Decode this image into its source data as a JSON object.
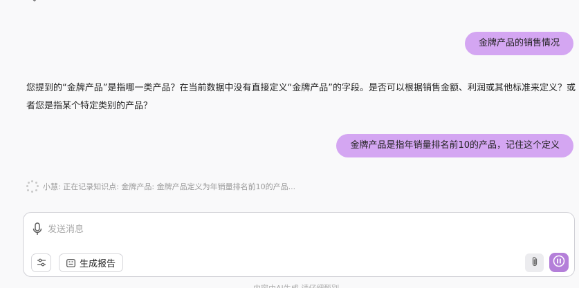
{
  "conversation": {
    "messages": [
      {
        "role": "user",
        "text": "金牌产品的销售情况"
      },
      {
        "role": "assistant",
        "text": "您提到的“金牌产品”是指哪一类产品？在当前数据中没有直接定义“金牌产品”的字段。是否可以根据销售金额、利润或其他标准来定义？或者您是指某个特定类别的产品？"
      },
      {
        "role": "user",
        "text": "金牌产品是指年销量排名前10的产品，记住这个定义"
      }
    ],
    "status": "小慧: 正在记录知识点: 金牌产品: 金牌产品定义为年销量排名前10的产品..."
  },
  "composer": {
    "placeholder": "发送消息",
    "value": "",
    "report_label": "生成报告"
  },
  "footer_cut_text": "内容由AI生成 请仔细甄别",
  "icons": {
    "mic": "microphone-icon",
    "settings": "sliders-icon",
    "report": "report-icon",
    "attach": "paperclip-icon",
    "stop": "stop-icon",
    "spinner": "loading-spinner-icon"
  },
  "colors": {
    "user_bubble": "#d4a6f2",
    "accent": "#b47fd9",
    "page_bg": "#f9f9fa"
  }
}
